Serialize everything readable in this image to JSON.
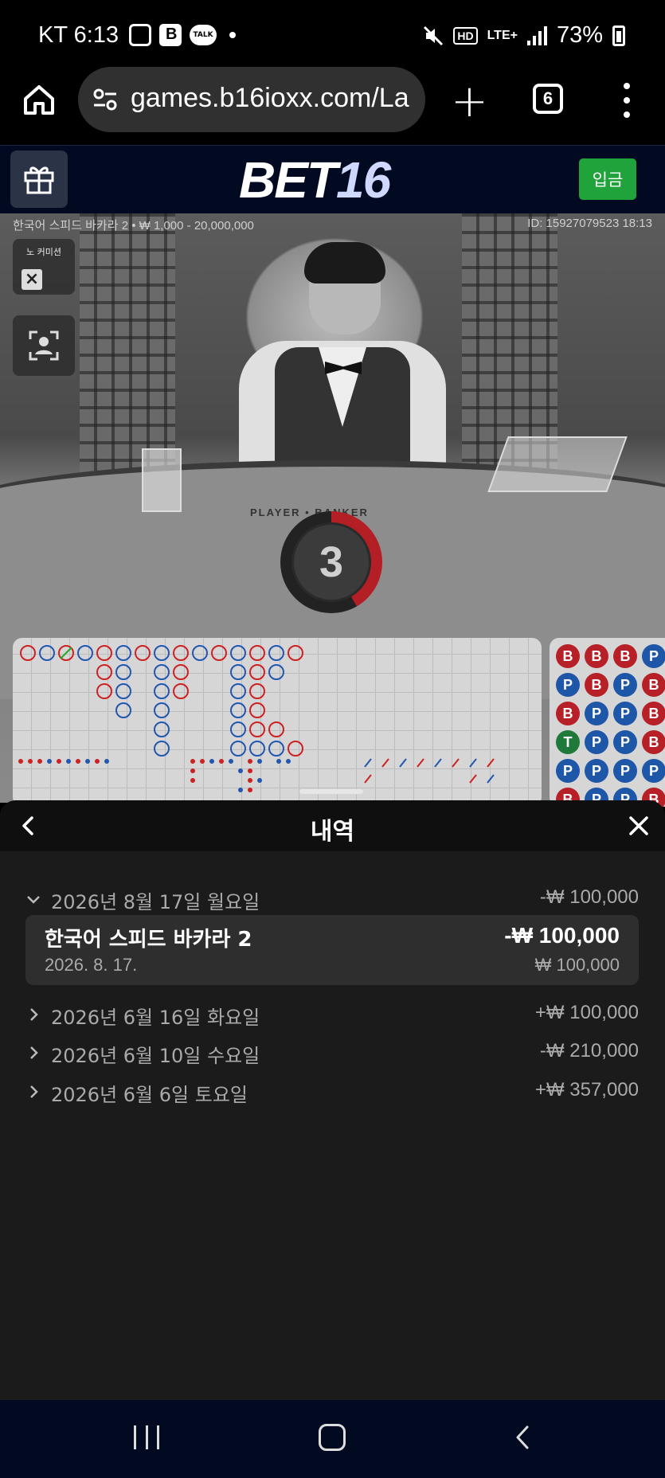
{
  "status_bar": {
    "time": "KT 6:13",
    "battery": "73%",
    "hd_label": "HD",
    "lte_label": "LTE+",
    "talk_label": "TALK"
  },
  "browser": {
    "url": "games.b16ioxx.com/La",
    "tab_count": "6"
  },
  "site": {
    "logo_part1": "BET",
    "logo_part2": "16",
    "deposit_label": "입금"
  },
  "game": {
    "info": "한국어 스피드 바카라 2 • ₩ 1,000 - 20,000,000",
    "id": "ID: 15927079523 18:13",
    "no_commission_label": "노 커미션",
    "table_text": "PLAYER • BANKER",
    "countdown": "3"
  },
  "bead_road": {
    "rows": [
      [
        "B",
        "B",
        "B",
        "P"
      ],
      [
        "P",
        "B",
        "P",
        "B"
      ],
      [
        "B",
        "P",
        "P",
        "B"
      ],
      [
        "T",
        "P",
        "P",
        "B"
      ],
      [
        "P",
        "P",
        "P",
        "P"
      ],
      [
        "B",
        "P",
        "P",
        "B"
      ]
    ]
  },
  "history": {
    "title": "내역",
    "days": [
      {
        "label": "2026년 8월 17일 월요일",
        "amount": "-₩ 100,000",
        "expanded": true
      },
      {
        "label": "2026년 6월 16일 화요일",
        "amount": "+₩ 100,000",
        "expanded": false
      },
      {
        "label": "2026년 6월 10일 수요일",
        "amount": "-₩ 210,000",
        "expanded": false
      },
      {
        "label": "2026년 6월 6일 토요일",
        "amount": "+₩ 357,000",
        "expanded": false
      }
    ],
    "bet": {
      "game": "한국어 스피드 바카라 2",
      "date": "2026. 8. 17.",
      "result": "-₩ 100,000",
      "stake": "₩ 100,000"
    }
  },
  "colors": {
    "banker": "#b82027",
    "player": "#1e56a8",
    "tie": "#1f7a3a",
    "deposit": "#1fa33a",
    "header_bg": "#020a22"
  }
}
